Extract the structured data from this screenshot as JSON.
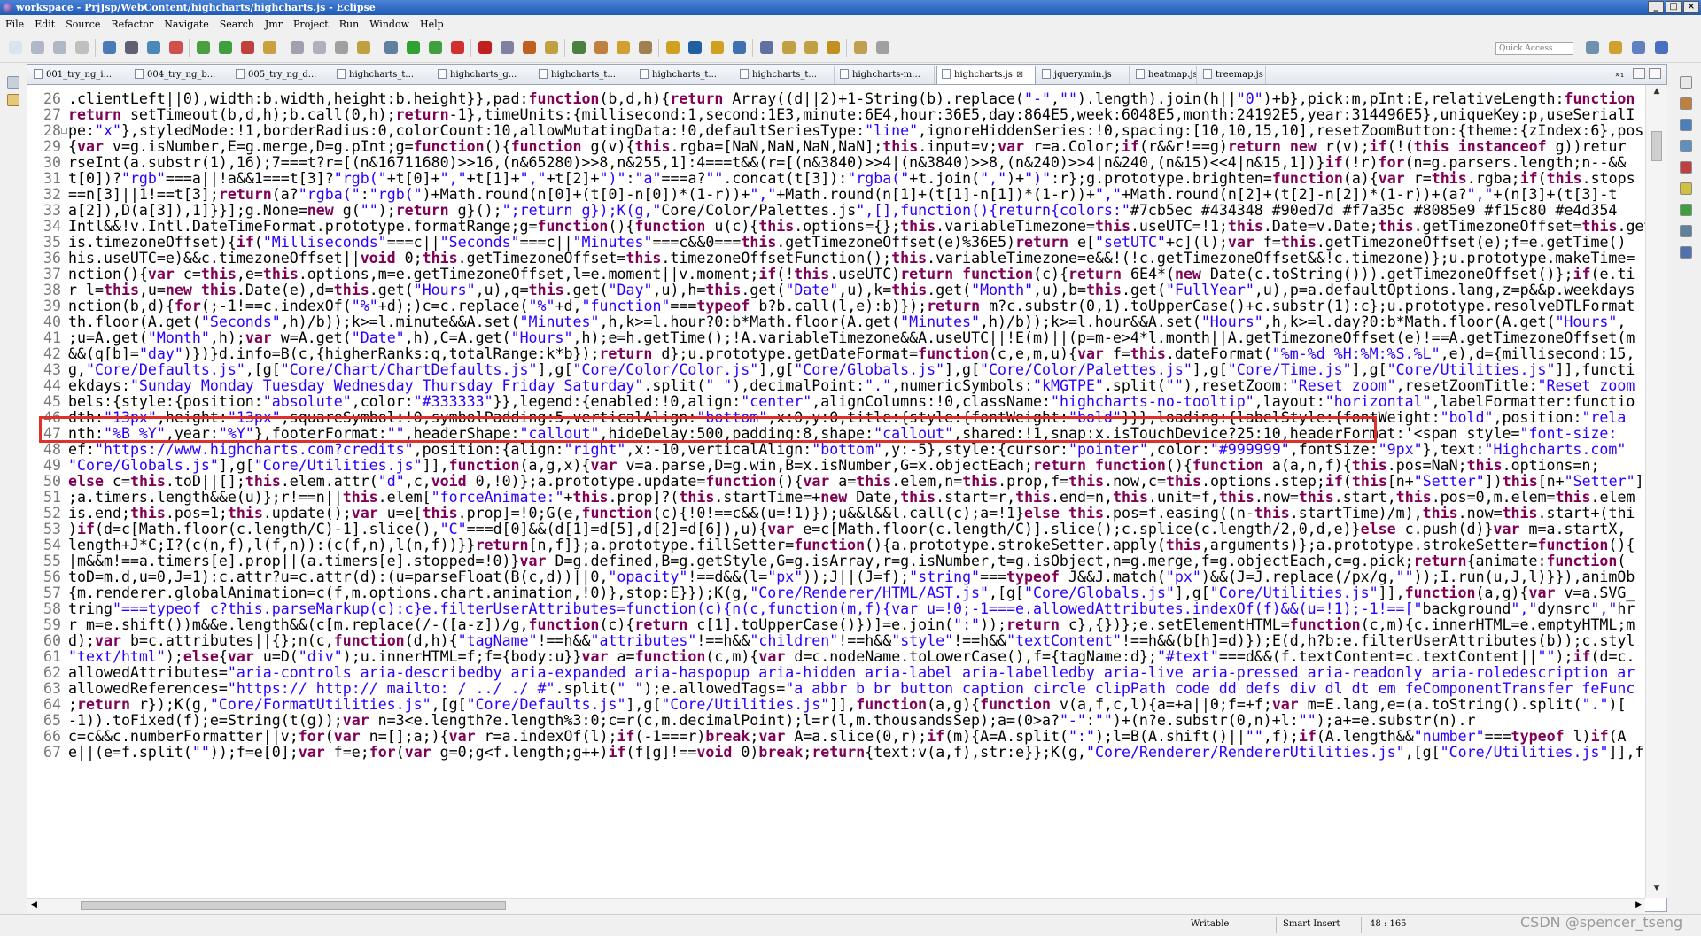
{
  "window": {
    "title": "workspace - PrjJsp/WebContent/highcharts/highcharts.js - Eclipse",
    "buttons": [
      "_",
      "□",
      "×"
    ]
  },
  "menubar": [
    "File",
    "Edit",
    "Source",
    "Refactor",
    "Navigate",
    "Search",
    "Jmr",
    "Project",
    "Run",
    "Window",
    "Help"
  ],
  "toolbar": {
    "quick_access_placeholder": "Quick Access"
  },
  "tabs": [
    {
      "label": "001_try_ng_i...",
      "active": false
    },
    {
      "label": "004_try_ng_b...",
      "active": false
    },
    {
      "label": "005_try_ng_d...",
      "active": false
    },
    {
      "label": "highcharts_t...",
      "active": false
    },
    {
      "label": "highcharts_g...",
      "active": false
    },
    {
      "label": "highcharts_t...",
      "active": false
    },
    {
      "label": "highcharts_t...",
      "active": false
    },
    {
      "label": "highcharts_t...",
      "active": false
    },
    {
      "label": "highcharts-m...",
      "active": false
    },
    {
      "label": "highcharts.js",
      "active": true,
      "close": "⊠"
    },
    {
      "label": "jquery.min.js",
      "active": false
    },
    {
      "label": "heatmap.js",
      "active": false
    },
    {
      "label": "treemap.js",
      "active": false
    }
  ],
  "tab_overflow": "»₁",
  "editor": {
    "lines": [
      {
        "n": "26",
        "t": ".clientLeft||0),width:b.width,height:b.height}},pad:function(b,d,h){return Array((d||2)+1-String(b).replace(\"-\",\"\").length).join(h||\"0\")+b},pick:m,pInt:E,relativeLength:function"
      },
      {
        "n": "27",
        "t": "return setTimeout(b,d,h);b.call(0,h);return-1},timeUnits:{millisecond:1,second:1E3,minute:6E4,hour:36E5,day:864E5,week:6048E5,month:24192E5,year:314496E5},uniqueKey:p,useSerialI"
      },
      {
        "n": "28",
        "t": "pe:\"x\"},styledMode:!1,borderRadius:0,colorCount:10,allowMutatingData:!0,defaultSeriesType:\"line\",ignoreHiddenSeries:!0,spacing:[10,10,15,10],resetZoomButton:{theme:{zIndex:6},posi",
        "fold": true
      },
      {
        "n": "29",
        "t": "{var v=g.isNumber,E=g.merge,D=g.pInt;g=function(){function g(v){this.rgba=[NaN,NaN,NaN,NaN];this.input=v;var r=a.Color;if(r&&r!==g)return new r(v);if(!(this instanceof g))retur"
      },
      {
        "n": "30",
        "t": "rseInt(a.substr(1),16);7===t?r=[(n&16711680)>>16,(n&65280)>>8,n&255,1]:4===t&&(r=[(n&3840)>>4|(n&3840)>>8,(n&240)>>4|n&240,(n&15)<<4|n&15,1])}if(!r)for(n=g.parsers.length;n--&&"
      },
      {
        "n": "31",
        "t": "t[0])?\"rgb\"===a||!a&&1===t[3]?\"rgb(\"+t[0]+\",\"+t[1]+\",\"+t[2]+\")\":\"a\"===a?\"\".concat(t[3]):\"rgba(\"+t.join(\",\")+\")\":r};g.prototype.brighten=function(a){var r=this.rgba;if(this.stops"
      },
      {
        "n": "32",
        "t": "==n[3]||1!==t[3];return(a?\"rgba(\":\"rgb(\")+Math.round(n[0]+(t[0]-n[0])*(1-r))+\",\"+Math.round(n[1]+(t[1]-n[1])*(1-r))+\",\"+Math.round(n[2]+(t[2]-n[2])*(1-r))+(a?\",\"+(n[3]+(t[3]-t"
      },
      {
        "n": "33",
        "t": "a[2]),D(a[3]),1]}}];g.None=new g(\"\");return g}();\";return g});K(g,\"Core/Color/Palettes.js\",[],function(){return{colors:\"#7cb5ec #434348 #90ed7d #f7a35c #8085e9 #f15c80 #e4d354"
      },
      {
        "n": "34",
        "t": "Intl&&!v.Intl.DateTimeFormat.prototype.formatRange;g=function(){function u(c){this.options={};this.variableTimezone=this.useUTC=!1;this.Date=v.Date;this.getTimezoneOffset=this.getT"
      },
      {
        "n": "35",
        "t": "is.timezoneOffset){if(\"Milliseconds\"===c||\"Seconds\"===c||\"Minutes\"===c&&0===this.getTimezoneOffset(e)%36E5)return e[\"setUTC\"+c](l);var f=this.getTimezoneOffset(e);f=e.getTime()"
      },
      {
        "n": "36",
        "t": "his.useUTC=e)&&c.timezoneOffset||void 0;this.getTimezoneOffset=this.timezoneOffsetFunction();this.variableTimezone=e&&!(!c.getTimezoneOffset&&!c.timezone)};u.prototype.makeTime="
      },
      {
        "n": "37",
        "t": "nction(){var c=this,e=this.options,m=e.getTimezoneOffset,l=e.moment||v.moment;if(!this.useUTC)return function(c){return 6E4*(new Date(c.toString())).getTimezoneOffset()};if(e.ti"
      },
      {
        "n": "38",
        "t": "r l=this,u=new this.Date(e),d=this.get(\"Hours\",u),q=this.get(\"Day\",u),h=this.get(\"Date\",u),k=this.get(\"Month\",u),b=this.get(\"FullYear\",u),p=a.defaultOptions.lang,z=p&&p.weekdays"
      },
      {
        "n": "39",
        "t": "nction(b,d){for(;-1!==c.indexOf(\"%\"+d);)c=c.replace(\"%\"+d,\"function\"===typeof b?b.call(l,e):b)});return m?c.substr(0,1).toUpperCase()+c.substr(1):c};u.prototype.resolveDTLFormat"
      },
      {
        "n": "40",
        "t": "th.floor(A.get(\"Seconds\",h)/b));k>=l.minute&&A.set(\"Minutes\",h,k>=l.hour?0:b*Math.floor(A.get(\"Minutes\",h)/b));k>=l.hour&&A.set(\"Hours\",h,k>=l.day?0:b*Math.floor(A.get(\"Hours\","
      },
      {
        "n": "41",
        "t": ";u=A.get(\"Month\",h);var w=A.get(\"Date\",h),C=A.get(\"Hours\",h);e=h.getTime();!A.variableTimezone&&A.useUTC||!E(m)||(p=m-e>4*l.month||A.getTimezoneOffset(e)!==A.getTimezoneOffset(m"
      },
      {
        "n": "42",
        "t": "&&(q[b]=\"day\")})}d.info=B(c,{higherRanks:q,totalRange:k*b});return d};u.prototype.getDateFormat=function(c,e,m,u){var f=this.dateFormat(\"%m-%d %H:%M:%S.%L\",e),d={millisecond:15,"
      },
      {
        "n": "43",
        "t": "g,\"Core/Defaults.js\",[g[\"Core/Chart/ChartDefaults.js\"],g[\"Core/Color/Color.js\"],g[\"Core/Globals.js\"],g[\"Core/Color/Palettes.js\"],g[\"Core/Time.js\"],g[\"Core/Utilities.js\"]],functi"
      },
      {
        "n": "44",
        "t": "ekdays:\"Sunday Monday Tuesday Wednesday Thursday Friday Saturday\".split(\" \"),decimalPoint:\".\",numericSymbols:\"kMGTPE\".split(\"\"),resetZoom:\"Reset zoom\",resetZoomTitle:\"Reset zoom"
      },
      {
        "n": "45",
        "t": "bels:{style:{position:\"absolute\",color:\"#333333\"}},legend:{enabled:!0,align:\"center\",alignColumns:!0,className:\"highcharts-no-tooltip\",layout:\"horizontal\",labelFormatter:functio"
      },
      {
        "n": "46",
        "t": "dth:\"13px\",height:\"13px\",squareSymbol:!0,symbolPadding:5,verticalAlign:\"bottom\",x:0,y:0,title:{style:{fontWeight:\"bold\"}}},loading:{labelStyle:{fontWeight:\"bold\",position:\"rela"
      },
      {
        "n": "47",
        "t": "nth:\"%B %Y\",year:\"%Y\"},footerFormat:\"\",headerShape:\"callout\",hideDelay:500,padding:8,shape:\"callout\",shared:!1,snap:x.isTouchDevice?25:10,headerFormat:'<span style=\"font-size:"
      },
      {
        "n": "48",
        "t": "ef:\"https://www.highcharts.com?credits\",position:{align:\"right\",x:-10,verticalAlign:\"bottom\",y:-5},style:{cursor:\"pointer\",color:\"#999999\",fontSize:\"9px\"},text:\"Highcharts.com\""
      },
      {
        "n": "49",
        "t": "\"Core/Globals.js\"],g[\"Core/Utilities.js\"]],function(a,g,x){var v=a.parse,D=g.win,B=x.isNumber,G=x.objectEach;return function(){function a(a,n,f){this.pos=NaN;this.options=n;"
      },
      {
        "n": "50",
        "t": "else c=this.toD||[];this.elem.attr(\"d\",c,void 0,!0)};a.prototype.update=function(){var a=this.elem,n=this.prop,f=this.now,c=this.options.step;if(this[n+\"Setter\"])this[n+\"Setter\"]"
      },
      {
        "n": "51",
        "t": ";a.timers.length&&e(u)};r!==n||this.elem[\"forceAnimate:\"+this.prop]?(this.startTime=+new Date,this.start=r,this.end=n,this.unit=f,this.now=this.start,this.pos=0,m.elem=this.elem"
      },
      {
        "n": "52",
        "t": "is.end;this.pos=1;this.update();var u=e[this.prop]=!0;G(e,function(c){!0!==c&&(u=!1)});u&&l&&l.call(c);a=!1}else this.pos=f.easing((n-this.startTime)/m),this.now=this.start+(thi"
      },
      {
        "n": "53",
        "t": ")if(d=c[Math.floor(c.length/C)-1].slice(),\"C\"===d[0]&&(d[1]=d[5],d[2]=d[6]),u){var e=c[Math.floor(c.length/C)].slice();c.splice(c.length/2,0,d,e)}else c.push(d)}var m=a.startX,"
      },
      {
        "n": "54",
        "t": "length+J*C;I?(c(n,f),l(f,n)):(c(f,n),l(n,f))}}return[n,f]};a.prototype.fillSetter=function(){a.prototype.strokeSetter.apply(this,arguments)};a.prototype.strokeSetter=function(){"
      },
      {
        "n": "55",
        "t": "|m&&m!==a.timers[e].prop||(a.timers[e].stopped=!0)}var D=g.defined,B=g.getStyle,G=g.isArray,r=g.isNumber,t=g.isObject,n=g.merge,f=g.objectEach,c=g.pick;return{animate:function("
      },
      {
        "n": "56",
        "t": "toD=m.d,u=0,J=1):c.attr?u=c.attr(d):(u=parseFloat(B(c,d))||0,\"opacity\"!==d&&(l=\"px\"));J||(J=f);\"string\"===typeof J&&J.match(\"px\")&&(J=J.replace(/px/g,\"\"));I.run(u,J,l)}}),animOb"
      },
      {
        "n": "57",
        "t": "{m.renderer.globalAnimation=c(f,m.options.chart.animation,!0)},stop:E}});K(g,\"Core/Renderer/HTML/AST.js\",[g[\"Core/Globals.js\"],g[\"Core/Utilities.js\"]],function(a,g){var v=a.SVG_"
      },
      {
        "n": "58",
        "t": "tring\"===typeof c?this.parseMarkup(c):c}e.filterUserAttributes=function(c){n(c,function(m,f){var u=!0;-1===e.allowedAttributes.indexOf(f)&&(u=!1);-1!==[\"background\",\"dynsrc\",\"hr"
      },
      {
        "n": "59",
        "t": "r m=e.shift())m&&e.length&&(c[m.replace(/-([a-z])/g,function(c){return c[1].toUpperCase()})]=e.join(\":\"));return c},{})};e.setElementHTML=function(c,m){c.innerHTML=e.emptyHTML;m"
      },
      {
        "n": "60",
        "t": "d);var b=c.attributes||{};n(c,function(d,h){\"tagName\"!==h&&\"attributes\"!==h&&\"children\"!==h&&\"style\"!==h&&\"textContent\"!==h&&(b[h]=d)});E(d,h?b:e.filterUserAttributes(b));c.styl"
      },
      {
        "n": "61",
        "t": "\"text/html\");else{var u=D(\"div\");u.innerHTML=f;f={body:u}}var a=function(c,m){var d=c.nodeName.toLowerCase(),f={tagName:d};\"#text\"===d&&(f.textContent=c.textContent||\"\");if(d=c."
      },
      {
        "n": "62",
        "t": "allowedAttributes=\"aria-controls aria-describedby aria-expanded aria-haspopup aria-hidden aria-label aria-labelledby aria-live aria-pressed aria-readonly aria-roledescription ar"
      },
      {
        "n": "63",
        "t": "allowedReferences=\"https:// http:// mailto: / ../ ./ #\".split(\" \");e.allowedTags=\"a abbr b br button caption circle clipPath code dd defs div dl dt em feComponentTransfer feFunc"
      },
      {
        "n": "64",
        "t": ";return r});K(g,\"Core/FormatUtilities.js\",[g[\"Core/Defaults.js\"],g[\"Core/Utilities.js\"]],function(a,g){function v(a,f,c,l){a=+a||0;f=+f;var m=E.lang,e=(a.toString().split(\".\")["
      },
      {
        "n": "65",
        "t": "-1)).toFixed(f);e=String(t(g));var n=3<e.length?e.length%3:0;c=r(c,m.decimalPoint);l=r(l,m.thousandsSep);a=(0>a?\"-\":\"\")+(n?e.substr(0,n)+l:\"\");a+=e.substr(n).r"
      },
      {
        "n": "66",
        "t": "c=c&&c.numberFormatter||v;for(var n=[];a;){var r=a.indexOf(l);if(-1===r)break;var A=a.slice(0,r);if(m){A=A.split(\":\");l=B(A.shift()||\"\",f);if(A.length&&\"number\"===typeof l)if(A"
      },
      {
        "n": "67",
        "t": "e||(e=f.split(\"\"));f=e[0];var f=e;for(var g=0;g<f.length;g++)if(f[g]!==void 0)break;return{text:v(a,f),str:e}};K(g,\"Core/Renderer/RendererUtilities.js\",[g[\"Core/Utilities.js\"]],fu"
      }
    ]
  },
  "statusbar": {
    "writable": "Writable",
    "insert_mode": "Smart Insert",
    "position": "48 : 165"
  },
  "watermark": "CSDN @spencer_tseng"
}
